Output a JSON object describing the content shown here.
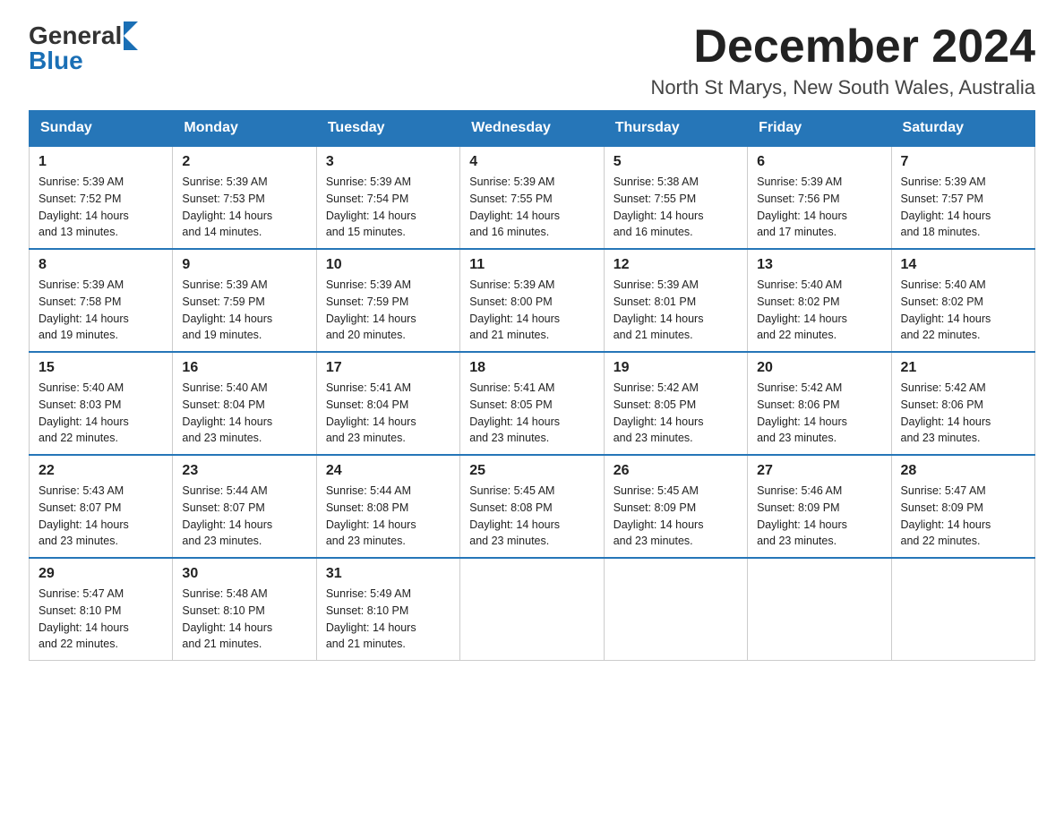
{
  "logo": {
    "general": "General",
    "blue": "Blue",
    "triangle": "▶"
  },
  "title": "December 2024",
  "location": "North St Marys, New South Wales, Australia",
  "days_of_week": [
    "Sunday",
    "Monday",
    "Tuesday",
    "Wednesday",
    "Thursday",
    "Friday",
    "Saturday"
  ],
  "weeks": [
    [
      {
        "day": "1",
        "sunrise": "5:39 AM",
        "sunset": "7:52 PM",
        "daylight": "14 hours and 13 minutes."
      },
      {
        "day": "2",
        "sunrise": "5:39 AM",
        "sunset": "7:53 PM",
        "daylight": "14 hours and 14 minutes."
      },
      {
        "day": "3",
        "sunrise": "5:39 AM",
        "sunset": "7:54 PM",
        "daylight": "14 hours and 15 minutes."
      },
      {
        "day": "4",
        "sunrise": "5:39 AM",
        "sunset": "7:55 PM",
        "daylight": "14 hours and 16 minutes."
      },
      {
        "day": "5",
        "sunrise": "5:38 AM",
        "sunset": "7:55 PM",
        "daylight": "14 hours and 16 minutes."
      },
      {
        "day": "6",
        "sunrise": "5:39 AM",
        "sunset": "7:56 PM",
        "daylight": "14 hours and 17 minutes."
      },
      {
        "day": "7",
        "sunrise": "5:39 AM",
        "sunset": "7:57 PM",
        "daylight": "14 hours and 18 minutes."
      }
    ],
    [
      {
        "day": "8",
        "sunrise": "5:39 AM",
        "sunset": "7:58 PM",
        "daylight": "14 hours and 19 minutes."
      },
      {
        "day": "9",
        "sunrise": "5:39 AM",
        "sunset": "7:59 PM",
        "daylight": "14 hours and 19 minutes."
      },
      {
        "day": "10",
        "sunrise": "5:39 AM",
        "sunset": "7:59 PM",
        "daylight": "14 hours and 20 minutes."
      },
      {
        "day": "11",
        "sunrise": "5:39 AM",
        "sunset": "8:00 PM",
        "daylight": "14 hours and 21 minutes."
      },
      {
        "day": "12",
        "sunrise": "5:39 AM",
        "sunset": "8:01 PM",
        "daylight": "14 hours and 21 minutes."
      },
      {
        "day": "13",
        "sunrise": "5:40 AM",
        "sunset": "8:02 PM",
        "daylight": "14 hours and 22 minutes."
      },
      {
        "day": "14",
        "sunrise": "5:40 AM",
        "sunset": "8:02 PM",
        "daylight": "14 hours and 22 minutes."
      }
    ],
    [
      {
        "day": "15",
        "sunrise": "5:40 AM",
        "sunset": "8:03 PM",
        "daylight": "14 hours and 22 minutes."
      },
      {
        "day": "16",
        "sunrise": "5:40 AM",
        "sunset": "8:04 PM",
        "daylight": "14 hours and 23 minutes."
      },
      {
        "day": "17",
        "sunrise": "5:41 AM",
        "sunset": "8:04 PM",
        "daylight": "14 hours and 23 minutes."
      },
      {
        "day": "18",
        "sunrise": "5:41 AM",
        "sunset": "8:05 PM",
        "daylight": "14 hours and 23 minutes."
      },
      {
        "day": "19",
        "sunrise": "5:42 AM",
        "sunset": "8:05 PM",
        "daylight": "14 hours and 23 minutes."
      },
      {
        "day": "20",
        "sunrise": "5:42 AM",
        "sunset": "8:06 PM",
        "daylight": "14 hours and 23 minutes."
      },
      {
        "day": "21",
        "sunrise": "5:42 AM",
        "sunset": "8:06 PM",
        "daylight": "14 hours and 23 minutes."
      }
    ],
    [
      {
        "day": "22",
        "sunrise": "5:43 AM",
        "sunset": "8:07 PM",
        "daylight": "14 hours and 23 minutes."
      },
      {
        "day": "23",
        "sunrise": "5:44 AM",
        "sunset": "8:07 PM",
        "daylight": "14 hours and 23 minutes."
      },
      {
        "day": "24",
        "sunrise": "5:44 AM",
        "sunset": "8:08 PM",
        "daylight": "14 hours and 23 minutes."
      },
      {
        "day": "25",
        "sunrise": "5:45 AM",
        "sunset": "8:08 PM",
        "daylight": "14 hours and 23 minutes."
      },
      {
        "day": "26",
        "sunrise": "5:45 AM",
        "sunset": "8:09 PM",
        "daylight": "14 hours and 23 minutes."
      },
      {
        "day": "27",
        "sunrise": "5:46 AM",
        "sunset": "8:09 PM",
        "daylight": "14 hours and 23 minutes."
      },
      {
        "day": "28",
        "sunrise": "5:47 AM",
        "sunset": "8:09 PM",
        "daylight": "14 hours and 22 minutes."
      }
    ],
    [
      {
        "day": "29",
        "sunrise": "5:47 AM",
        "sunset": "8:10 PM",
        "daylight": "14 hours and 22 minutes."
      },
      {
        "day": "30",
        "sunrise": "5:48 AM",
        "sunset": "8:10 PM",
        "daylight": "14 hours and 21 minutes."
      },
      {
        "day": "31",
        "sunrise": "5:49 AM",
        "sunset": "8:10 PM",
        "daylight": "14 hours and 21 minutes."
      },
      null,
      null,
      null,
      null
    ]
  ],
  "labels": {
    "sunrise": "Sunrise:",
    "sunset": "Sunset:",
    "daylight": "Daylight:"
  }
}
